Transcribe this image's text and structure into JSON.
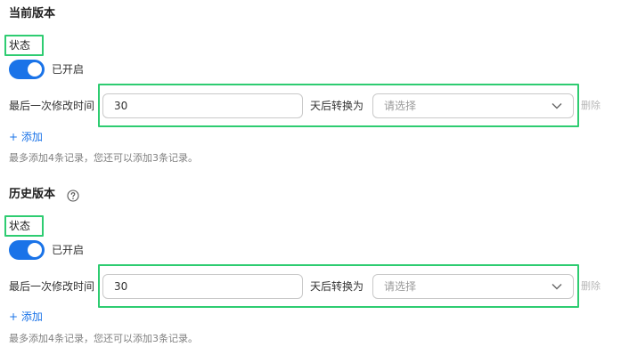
{
  "colors": {
    "accent": "#1a73e8",
    "highlight": "#2ecc71",
    "border": "#c9c9c9",
    "muted": "#808080",
    "disabled": "#b8b8b8"
  },
  "current": {
    "title": "当前版本",
    "status_label": "状态",
    "toggle_on": true,
    "toggle_text": "已开启",
    "rule": {
      "days_label": "最后一次修改时间",
      "days_value": "30",
      "transition_label": "天后转换为",
      "storage_placeholder": "请选择",
      "delete_label": "删除"
    },
    "add_label": "+ 添加",
    "hint": "最多添加4条记录，您还可以添加3条记录。"
  },
  "history": {
    "title": "历史版本",
    "help_icon": "question-circle-icon",
    "status_label": "状态",
    "toggle_on": true,
    "toggle_text": "已开启",
    "rule": {
      "days_label": "最后一次修改时间",
      "days_value": "30",
      "transition_label": "天后转换为",
      "storage_placeholder": "请选择",
      "delete_label": "删除"
    },
    "add_label": "+ 添加",
    "hint": "最多添加4条记录，您还可以添加3条记录。"
  }
}
